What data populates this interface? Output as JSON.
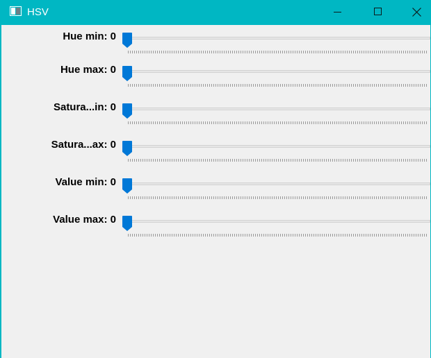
{
  "window": {
    "title": "HSV",
    "accent_color": "#00b7c3",
    "controls": [
      "minimize-icon",
      "maximize-icon",
      "close-icon"
    ]
  },
  "trackbars": [
    {
      "label": "Hue min: 0",
      "value": 0
    },
    {
      "label": "Hue max: 0",
      "value": 0
    },
    {
      "label": "Satura...in: 0",
      "value": 0
    },
    {
      "label": "Satura...ax: 0",
      "value": 0
    },
    {
      "label": "Value min: 0",
      "value": 0
    },
    {
      "label": "Value max: 0",
      "value": 0
    }
  ]
}
